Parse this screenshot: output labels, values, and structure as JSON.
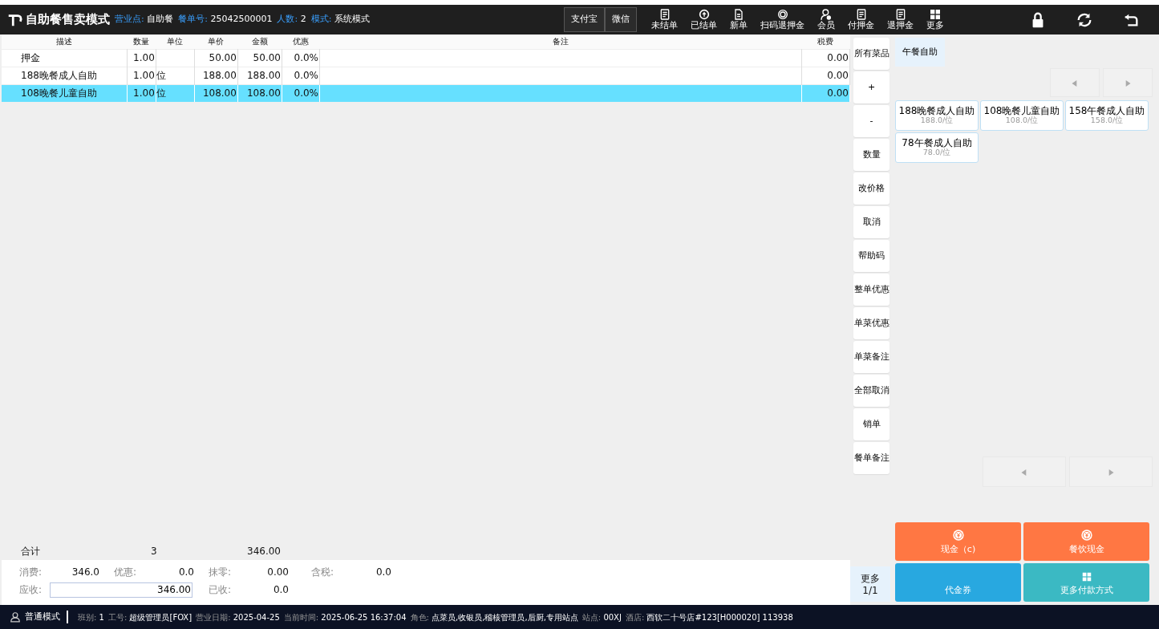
{
  "header": {
    "title": "自助餐售卖模式",
    "info": [
      {
        "label": "营业点:",
        "value": "自助餐"
      },
      {
        "label": "餐单号:",
        "value": "25042500001"
      },
      {
        "label": "人数:",
        "value": "2"
      },
      {
        "label": "模式:",
        "value": "系统模式"
      }
    ],
    "pay_buttons": [
      "支付宝",
      "微信"
    ],
    "tools": [
      {
        "label": "未结单",
        "kind": "doc"
      },
      {
        "label": "已结单",
        "kind": "circle"
      },
      {
        "label": "新单",
        "kind": "page"
      },
      {
        "label": "扫码退押金",
        "kind": "ring"
      },
      {
        "label": "会员",
        "kind": "person"
      },
      {
        "label": "付押金",
        "kind": "doc"
      },
      {
        "label": "退押金",
        "kind": "doc"
      },
      {
        "label": "更多",
        "kind": "grid"
      }
    ],
    "actions": [
      {
        "kind": "lock"
      },
      {
        "kind": "refresh"
      },
      {
        "kind": "back"
      }
    ]
  },
  "table": {
    "columns": [
      "描述",
      "数量",
      "单位",
      "单价",
      "金额",
      "优惠",
      "备注",
      "税费"
    ],
    "rows": [
      {
        "cells": [
          "押金",
          "1.00",
          "",
          "50.00",
          "50.00",
          "0.0%",
          "",
          "0.00"
        ],
        "selected": false
      },
      {
        "cells": [
          "188晚餐成人自助",
          "1.00",
          "位",
          "188.00",
          "188.00",
          "0.0%",
          "",
          "0.00"
        ],
        "selected": false
      },
      {
        "cells": [
          "108晚餐儿童自助",
          "1.00",
          "位",
          "108.00",
          "108.00",
          "0.0%",
          "",
          "0.00"
        ],
        "selected": true
      }
    ]
  },
  "totals": {
    "label": "合计",
    "quantity": "3",
    "amount": "346.00"
  },
  "summary": {
    "fields": [
      {
        "label": "消费:",
        "value": "346.0",
        "kind": "text"
      },
      {
        "label": "优惠:",
        "value": "0.0",
        "kind": "text"
      },
      {
        "label": "抹零:",
        "value": "0.00",
        "kind": "text"
      },
      {
        "label": "含税:",
        "value": "0.0",
        "kind": "text"
      },
      {
        "label": "应收:",
        "value": "346.00",
        "kind": "input"
      },
      {
        "label": "已收:",
        "value": "0.0",
        "kind": "text"
      }
    ]
  },
  "side_buttons": [
    "所有菜品",
    "+",
    "-",
    "数量",
    "改价格",
    "取消",
    "帮助码",
    "整单优惠",
    "单菜优惠",
    "单菜备注",
    "全部取消",
    "销单",
    "餐单备注"
  ],
  "more": {
    "label": "更多",
    "page": "1/1"
  },
  "categories": [
    {
      "label": "午餐自助",
      "selected": true
    }
  ],
  "dishes": [
    {
      "name": "188晚餐成人自助",
      "price": "188.0/位"
    },
    {
      "name": "108晚餐儿童自助",
      "price": "108.0/位"
    },
    {
      "name": "158午餐成人自助",
      "price": "158.0/位"
    },
    {
      "name": "78午餐成人自助",
      "price": "78.0/位"
    }
  ],
  "payments": [
    {
      "label": "现金（c)",
      "kind": "cash",
      "color": "#ff7743"
    },
    {
      "label": "餐饮现金",
      "kind": "cash",
      "color": "#ff7743"
    },
    {
      "label": "代金券",
      "kind": "plain",
      "color": "#28a8e0"
    },
    {
      "label": "更多付款方式",
      "kind": "grid",
      "color": "#3bb9c3"
    }
  ],
  "status_bar": {
    "mode": "普通模式",
    "fields": [
      {
        "label": "班别:",
        "value": "1"
      },
      {
        "label": "工号:",
        "value": "超级管理员[FOX]"
      },
      {
        "label": "营业日期:",
        "value": "2025-04-25"
      },
      {
        "label": "当前时间:",
        "value": "2025-06-25 16:37:04"
      },
      {
        "label": "角色:",
        "value": "点菜员,收银员,稽核管理员,后厨,专用站点"
      },
      {
        "label": "站点:",
        "value": "00XJ"
      },
      {
        "label": "酒店:",
        "value": "西软二十号店#123[H000020]  113938"
      }
    ]
  }
}
